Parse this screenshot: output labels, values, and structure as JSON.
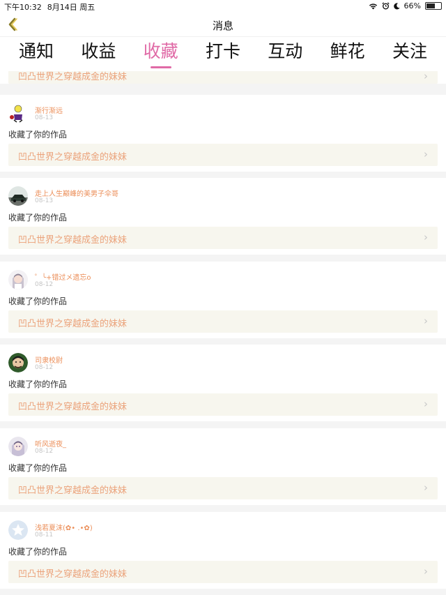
{
  "status_bar": {
    "time": "下午10:32",
    "date": "8月14日 周五",
    "battery_percent": "66%",
    "battery_level": 0.66
  },
  "nav": {
    "title": "消息",
    "back_icon": "chevron-left-icon"
  },
  "tabs": [
    {
      "label": "通知",
      "active": false
    },
    {
      "label": "收益",
      "active": false
    },
    {
      "label": "收藏",
      "active": true
    },
    {
      "label": "打卡",
      "active": false
    },
    {
      "label": "互动",
      "active": false
    },
    {
      "label": "鲜花",
      "active": false
    },
    {
      "label": "关注",
      "active": false
    }
  ],
  "colors": {
    "accent": "#e06aa6",
    "username": "#eb8e58",
    "work_title": "#eba27a",
    "link_bg": "#f7f6ee"
  },
  "partial_item": {
    "work_title": "凹凸世界之穿越成金的妹妹"
  },
  "items": [
    {
      "username": "渐行渐远",
      "date": "08-13",
      "action": "收藏了你的作品",
      "work_title": "凹凸世界之穿越成金的妹妹",
      "avatar": "figure"
    },
    {
      "username": "走上人生巅峰的美男子伞哥",
      "date": "08-13",
      "action": "收藏了你的作品",
      "work_title": "凹凸世界之穿越成金的妹妹",
      "avatar": "car"
    },
    {
      "username": "゜╰+错过メ遗忘o",
      "date": "08-12",
      "action": "收藏了你的作品",
      "work_title": "凹凸世界之穿越成金的妹妹",
      "avatar": "girl"
    },
    {
      "username": "司隶校尉",
      "date": "08-12",
      "action": "收藏了你的作品",
      "work_title": "凹凸世界之穿越成金的妹妹",
      "avatar": "man"
    },
    {
      "username": "听风逝夜_",
      "date": "08-12",
      "action": "收藏了你的作品",
      "work_title": "凹凸世界之穿越成金的妹妹",
      "avatar": "anime"
    },
    {
      "username": "浅若夏沫(✿• .•✿)",
      "date": "08-11",
      "action": "收藏了你的作品",
      "work_title": "凹凸世界之穿越成金的妹妹",
      "avatar": "star"
    }
  ]
}
